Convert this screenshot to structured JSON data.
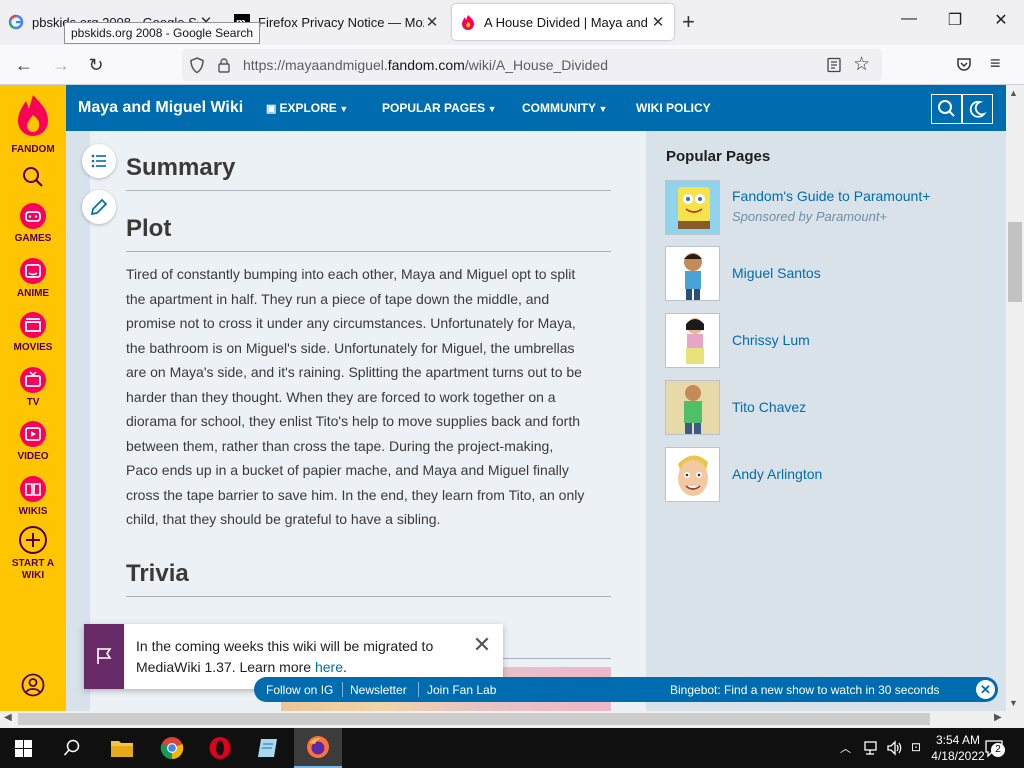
{
  "browser": {
    "tabs": [
      {
        "title": "pbskids.org 2008 - Google Search",
        "active": false
      },
      {
        "title": "Firefox Privacy Notice — Mozilla",
        "active": false
      },
      {
        "title": "A House Divided | Maya and Miguel Wiki",
        "active": true
      }
    ],
    "tooltip": "pbskids.org 2008 - Google Search",
    "url_prefix": "https://mayaandmiguel.",
    "url_domain": "fandom.com",
    "url_path": "/wiki/A_House_Divided"
  },
  "fandom_rail": {
    "logo_label": "FANDOM",
    "items": [
      "GAMES",
      "ANIME",
      "MOVIES",
      "TV",
      "VIDEO",
      "WIKIS",
      "START A WIKI"
    ],
    "start_line1": "START A",
    "start_line2": "WIKI"
  },
  "wiki_header": {
    "name": "Maya and Miguel Wiki",
    "nav": {
      "explore": "EXPLORE",
      "popular": "POPULAR PAGES",
      "community": "COMMUNITY",
      "policy": "WIKI POLICY"
    }
  },
  "article": {
    "summary_heading": "Summary",
    "plot_heading": "Plot",
    "plot_lines": [
      "Tired of constantly bumping into each other, Maya and Miguel opt to split",
      "the apartment in half. They run a piece of tape down the middle, and",
      "promise not to cross it under any circumstances. Unfortunately for Maya,",
      "the bathroom is on Miguel's side. Unfortunately for Miguel, the umbrellas",
      "are on Maya's side, and it's raining. Splitting the apartment turns out to be",
      "harder than they thought. When they are forced to work together on a",
      "diorama for school, they enlist Tito's help to move supplies back and forth",
      "between them, rather than cross the tape. During the project-making,",
      "Paco ends up in a bucket of papier mache, and Maya and Miguel finally",
      "cross the tape barrier to save him. In the end, they learn from Tito, an only",
      "child, that they should be grateful to have a sibling."
    ],
    "trivia_heading": "Trivia"
  },
  "sidebar": {
    "title": "Popular Pages",
    "items": [
      {
        "name": "Fandom's Guide to Paramount+",
        "sub": "Sponsored by Paramount+"
      },
      {
        "name": "Miguel Santos",
        "sub": ""
      },
      {
        "name": "Chrissy Lum",
        "sub": ""
      },
      {
        "name": "Tito Chavez",
        "sub": ""
      },
      {
        "name": "Andy Arlington",
        "sub": ""
      }
    ]
  },
  "notice": {
    "text_before": "In the coming weeks this wiki will be migrated to MediaWiki 1.37. Learn more ",
    "link": "here",
    "text_after": "."
  },
  "fan_strip": {
    "links": [
      "Follow on IG",
      "Newsletter",
      "Join Fan Lab"
    ],
    "promo": "Bingebot: Find a new show to watch in 30 seconds"
  },
  "taskbar": {
    "time": "3:54 AM",
    "date": "4/18/2022",
    "notifications": "2"
  },
  "colors": {
    "fandom_yellow": "#ffc500",
    "wiki_blue": "#006cb0",
    "link_blue": "#006cb0",
    "notice_purple": "#672a66"
  }
}
